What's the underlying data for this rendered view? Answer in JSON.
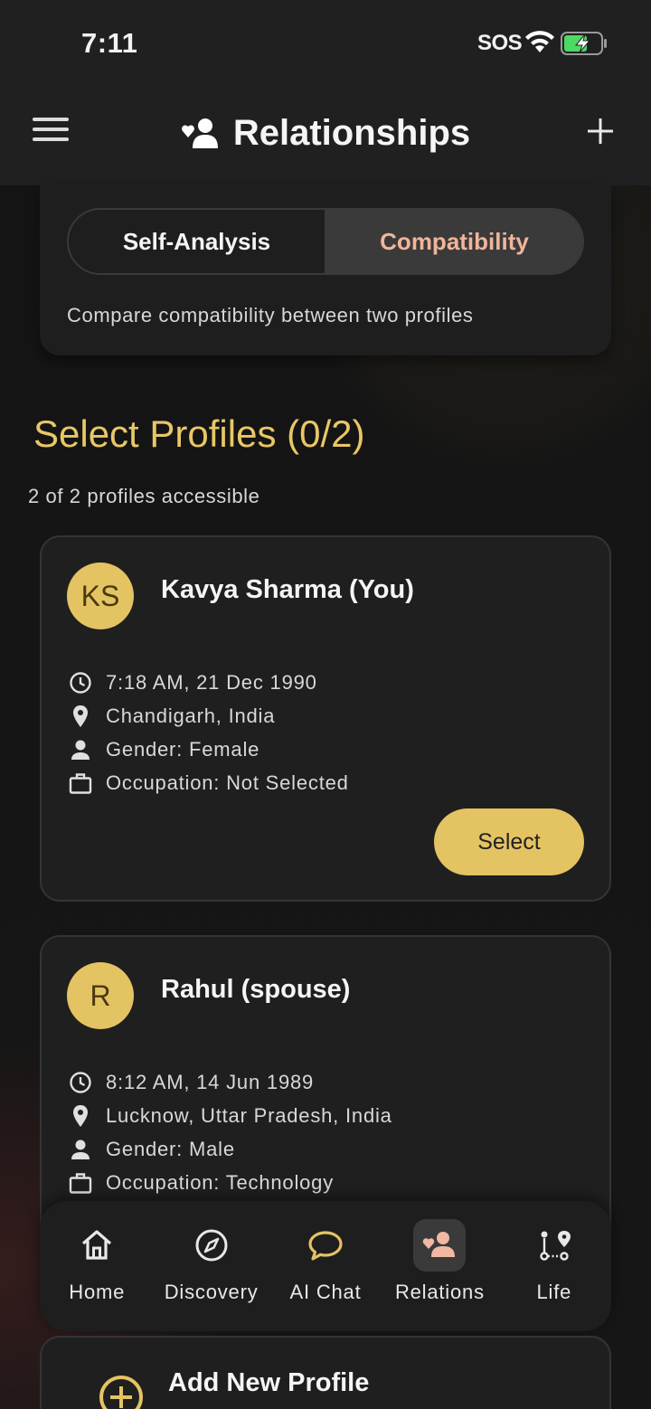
{
  "status_bar": {
    "time": "7:11",
    "carrier": "SOS"
  },
  "header": {
    "title": "Relationships"
  },
  "mode": {
    "tabs": [
      {
        "label": "Self-Analysis",
        "active": false
      },
      {
        "label": "Compatibility",
        "active": true
      }
    ],
    "description": "Compare compatibility between two profiles"
  },
  "selection": {
    "title": "Select Profiles (0/2)",
    "subtitle": "2 of 2 profiles accessible"
  },
  "profiles": [
    {
      "initials": "KS",
      "name": "Kavya Sharma (You)",
      "datetime": "7:18 AM, 21 Dec 1990",
      "location": "Chandigarh, India",
      "gender": "Gender: Female",
      "occupation": "Occupation: Not Selected",
      "select_label": "Select"
    },
    {
      "initials": "R",
      "name": "Rahul (spouse)",
      "datetime": "8:12 AM, 14 Jun 1989",
      "location": "Lucknow, Uttar Pradesh, India",
      "gender": "Gender: Male",
      "occupation": "Occupation: Technology"
    }
  ],
  "nav": [
    {
      "label": "Home",
      "icon": "home-icon"
    },
    {
      "label": "Discovery",
      "icon": "compass-icon"
    },
    {
      "label": "AI Chat",
      "icon": "chat-bubble-icon"
    },
    {
      "label": "Relations",
      "icon": "people-heart-icon",
      "active": true
    },
    {
      "label": "Life",
      "icon": "timeline-nodes-icon"
    }
  ],
  "add_profile": {
    "label": "Add New Profile"
  },
  "colors": {
    "accent_gold": "#e4c363",
    "active_tab_text": "#f0b59a",
    "background": "#141414"
  }
}
